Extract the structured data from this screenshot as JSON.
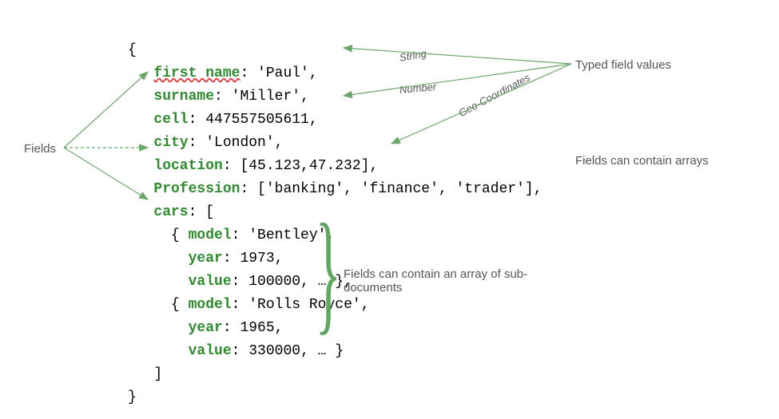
{
  "labels": {
    "fields": "Fields",
    "typed": "Typed field values",
    "arrays": "Fields can contain arrays",
    "subdocs": "Fields can contain an array of sub-documents",
    "type_string": "String",
    "type_number": "Number",
    "type_geo": "Geo-Coordinates"
  },
  "doc": {
    "first_name_key": "first name",
    "first_name_val": "'Paul'",
    "surname_key": "surname",
    "surname_val": "'Miller'",
    "cell_key": "cell",
    "cell_val": "447557505611",
    "city_key": "city",
    "city_val": "'London'",
    "location_key": "location",
    "location_val": "[45.123,47.232]",
    "profession_key": "Profession",
    "profession_val": "['banking', 'finance', 'trader']",
    "cars_key": "cars",
    "car1_model_key": "model",
    "car1_model_val": "'Bentley'",
    "car1_year_key": "year",
    "car1_year_val": "1973",
    "car1_value_key": "value",
    "car1_value_val": "100000",
    "car2_model_key": "model",
    "car2_model_val": "'Rolls Royce'",
    "car2_year_key": "year",
    "car2_year_val": "1965",
    "car2_value_key": "value",
    "car2_value_val": "330000",
    "ellipsis": "…",
    "punct": {
      "open": "{",
      "close": "}",
      "open_sq": "[",
      "close_sq": "]",
      "colon": ":",
      "comma": ",",
      "space": " "
    }
  }
}
